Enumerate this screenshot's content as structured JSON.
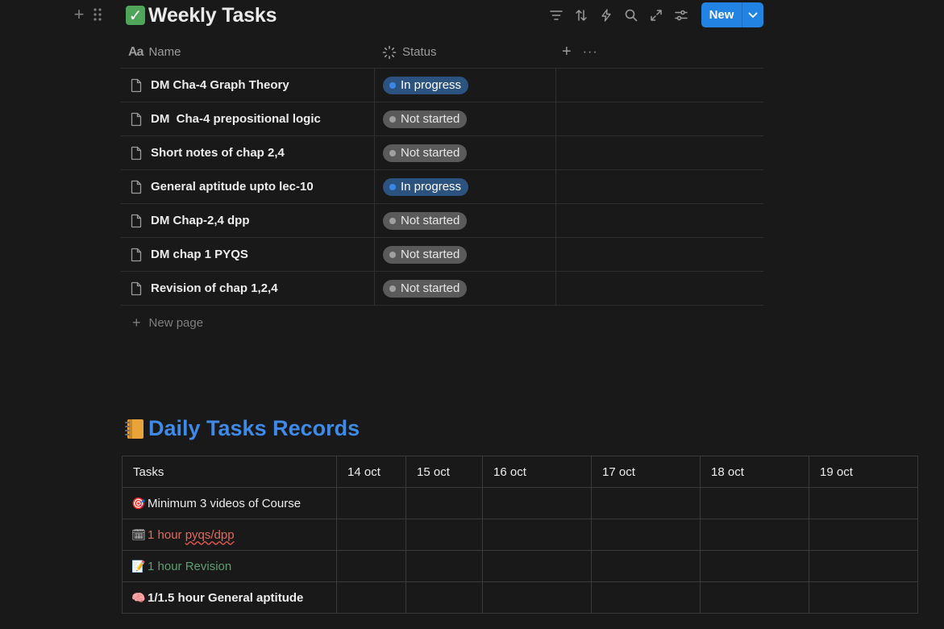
{
  "weekly": {
    "emoji": "✓",
    "title": "Weekly Tasks",
    "new_label": "New",
    "columns": {
      "name": "Name",
      "status": "Status"
    },
    "rows": [
      {
        "title": "DM Cha-4 Graph Theory",
        "status": "In progress",
        "status_kind": "inprog"
      },
      {
        "title": "DM  Cha-4 prepositional logic",
        "status": "Not started",
        "status_kind": "notst"
      },
      {
        "title": "Short notes of chap 2,4",
        "status": "Not started",
        "status_kind": "notst"
      },
      {
        "title": "General aptitude upto lec-10",
        "status": "In progress",
        "status_kind": "inprog"
      },
      {
        "title": "DM Chap-2,4 dpp",
        "status": "Not started",
        "status_kind": "notst"
      },
      {
        "title": "DM chap 1 PYQS",
        "status": "Not started",
        "status_kind": "notst"
      },
      {
        "title": "Revision of chap 1,2,4",
        "status": "Not started",
        "status_kind": "notst"
      }
    ],
    "new_page": "New page",
    "colors": {
      "accent": "#2383e2",
      "in_progress": "#2c5380",
      "not_started": "#5a5a5a"
    }
  },
  "daily": {
    "title": "Daily Tasks Records",
    "header": [
      "Tasks",
      "14 oct",
      "15 oct",
      "16 oct",
      "17 oct",
      "18 oct",
      "19 oct"
    ],
    "tasks": [
      {
        "emoji": "🎯",
        "label": "Minimum 3 videos of Course",
        "color": "white"
      },
      {
        "emoji": "🗓",
        "label_a": "1 hour ",
        "label_b": "pyqs/dpp",
        "color": "red"
      },
      {
        "emoji": "📝",
        "label": "1 hour Revision",
        "color": "green"
      },
      {
        "emoji": "🧠",
        "label": "1/1.5 hour General aptitude",
        "color": "white-bold"
      }
    ]
  }
}
